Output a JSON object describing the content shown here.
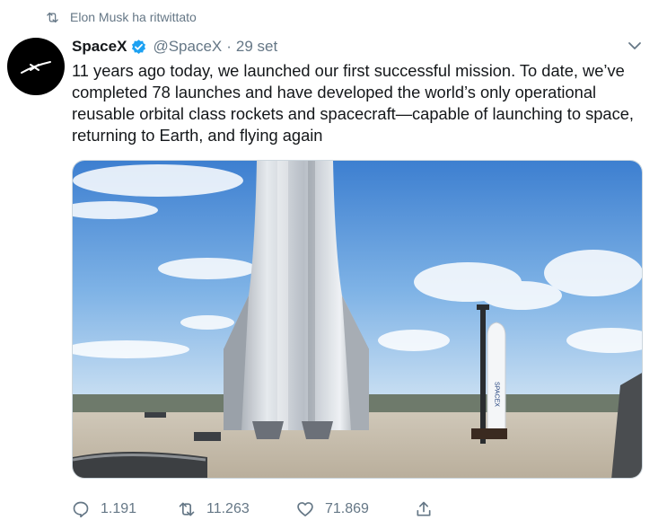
{
  "retweet_context": {
    "label": "Elon Musk ha ritwittato",
    "icon": "retweet-icon"
  },
  "tweet": {
    "author_name": "SpaceX",
    "handle": "@SpaceX",
    "separator": "·",
    "date": "29 set",
    "verified": true,
    "text": "11 years ago today, we launched our first successful mission. To date, we’ve\ncompleted 78 launches and have developed the world’s only operational\nreusable orbital class rockets and spacecraft—capable of launching to space,\nreturning to Earth, and flying again"
  },
  "media": {
    "rocket_lettering": "SPACEX"
  },
  "actions": {
    "replies": "1.191",
    "retweets": "11.263",
    "likes": "71.869"
  },
  "colors": {
    "text_primary": "#14171a",
    "text_secondary": "#657786",
    "verified_blue": "#1da1f2",
    "border": "#ccd6dd"
  }
}
